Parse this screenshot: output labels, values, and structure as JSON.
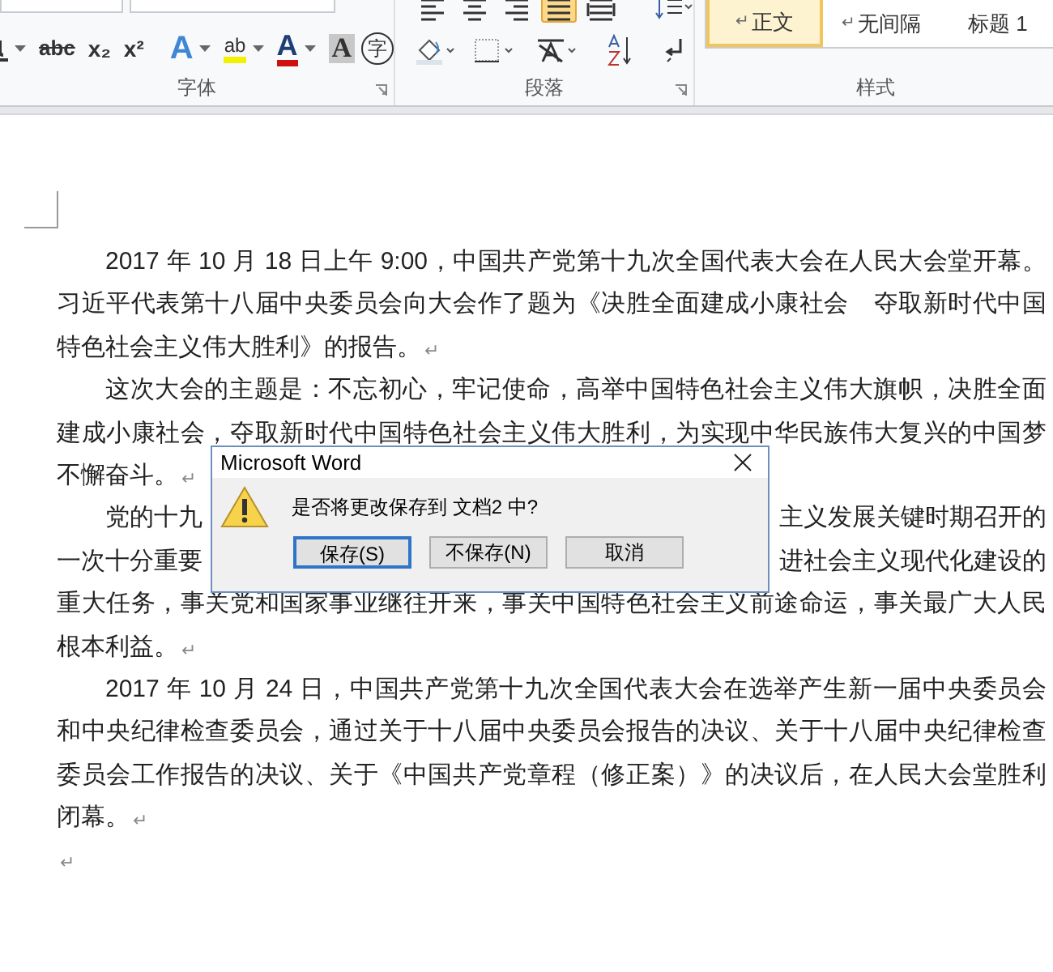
{
  "ribbon": {
    "font_group": {
      "label": "字体",
      "buttons": [
        {
          "kind": "strike",
          "glyph": "abc",
          "menu": false
        },
        {
          "kind": "sub",
          "glyph": "x₂",
          "menu": false
        },
        {
          "kind": "sup",
          "glyph": "x²",
          "menu": false
        },
        {
          "kind": "effects",
          "glyph": "A",
          "menu": true
        },
        {
          "kind": "highlight",
          "glyph": "ab",
          "menu": true
        },
        {
          "kind": "color",
          "glyph": "A",
          "menu": true
        },
        {
          "kind": "shade",
          "glyph": "A",
          "menu": false
        },
        {
          "kind": "enclose",
          "glyph": "字",
          "menu": false
        }
      ]
    },
    "paragraph_group": {
      "label": "段落",
      "alignments": [
        {
          "kind": "left",
          "selected": false
        },
        {
          "kind": "center",
          "selected": false
        },
        {
          "kind": "right",
          "selected": false
        },
        {
          "kind": "justify",
          "selected": true
        },
        {
          "kind": "distributed",
          "selected": false
        }
      ]
    },
    "styles_group": {
      "label": "样式",
      "styles": [
        {
          "mark": "↵",
          "name": "正文",
          "selected": true
        },
        {
          "mark": "↵",
          "name": "无间隔",
          "selected": false
        },
        {
          "name": "标题 1",
          "selected": false
        }
      ]
    }
  },
  "document": {
    "lines": [
      {
        "kind": "indent-justify",
        "text": "2017 年 10 月 18 日上午 9:00，中国共产党第十九次全国代表大会在人民大会堂开幕。"
      },
      {
        "kind": "justify",
        "text": "习近平代表第十八届中央委员会向大会作了题为《决胜全面建成小康社会　夺取新时代中国"
      },
      {
        "kind": "end",
        "text": "特色社会主义伟大胜利》的报告。",
        "mark": "↵"
      },
      {
        "kind": "indent-justify",
        "text": "这次大会的主题是：不忘初心，牢记使命，高举中国特色社会主义伟大旗帜，决胜全面"
      },
      {
        "kind": "justify",
        "text": "建成小康社会，夺取新时代中国特色社会主义伟大胜利，为实现中华民族伟大复兴的中国梦"
      },
      {
        "kind": "end",
        "text": "不懈奋斗。",
        "mark": "↵"
      },
      {
        "kind": "indent-split",
        "left": "党的十九",
        "right": "主义发展关键时期召开的"
      },
      {
        "kind": "split",
        "left": "一次十分重要",
        "right": "进社会主义现代化建设的"
      },
      {
        "kind": "justify",
        "text": "重大任务，事关党和国家事业继往开来，事关中国特色社会主义前途命运，事关最广大人民"
      },
      {
        "kind": "end",
        "text": "根本利益。",
        "mark": "↵"
      },
      {
        "kind": "indent-justify",
        "text": "2017 年 10 月 24 日，中国共产党第十九次全国代表大会在选举产生新一届中央委员会"
      },
      {
        "kind": "justify",
        "text": "和中央纪律检查委员会，通过关于十八届中央委员会报告的决议、关于十八届中央纪律检查"
      },
      {
        "kind": "justify",
        "text": "委员会工作报告的决议、关于《中国共产党章程（修正案）》的决议后，在人民大会堂胜利"
      },
      {
        "kind": "end",
        "text": "闭幕。",
        "mark": "↵"
      },
      {
        "kind": "empty",
        "mark": "↵"
      }
    ]
  },
  "dialog": {
    "title": "Microsoft Word",
    "message": "是否将更改保存到 文档2 中?",
    "buttons": [
      {
        "label": "保存(S)",
        "focused": true
      },
      {
        "label": "不保存(N)",
        "focused": false
      },
      {
        "label": "取消",
        "focused": false
      }
    ]
  }
}
